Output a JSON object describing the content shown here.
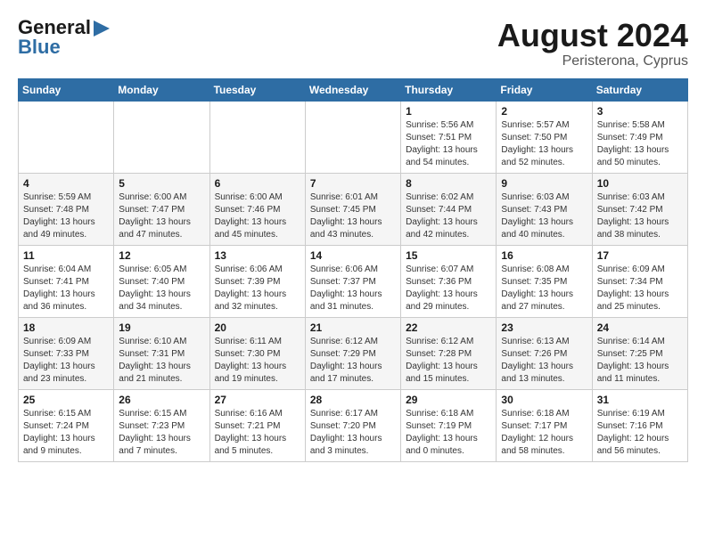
{
  "logo": {
    "general": "General",
    "blue": "Blue"
  },
  "header": {
    "month": "August 2024",
    "location": "Peristerona, Cyprus"
  },
  "weekdays": [
    "Sunday",
    "Monday",
    "Tuesday",
    "Wednesday",
    "Thursday",
    "Friday",
    "Saturday"
  ],
  "weeks": [
    [
      {
        "day": "",
        "info": ""
      },
      {
        "day": "",
        "info": ""
      },
      {
        "day": "",
        "info": ""
      },
      {
        "day": "",
        "info": ""
      },
      {
        "day": "1",
        "info": "Sunrise: 5:56 AM\nSunset: 7:51 PM\nDaylight: 13 hours\nand 54 minutes."
      },
      {
        "day": "2",
        "info": "Sunrise: 5:57 AM\nSunset: 7:50 PM\nDaylight: 13 hours\nand 52 minutes."
      },
      {
        "day": "3",
        "info": "Sunrise: 5:58 AM\nSunset: 7:49 PM\nDaylight: 13 hours\nand 50 minutes."
      }
    ],
    [
      {
        "day": "4",
        "info": "Sunrise: 5:59 AM\nSunset: 7:48 PM\nDaylight: 13 hours\nand 49 minutes."
      },
      {
        "day": "5",
        "info": "Sunrise: 6:00 AM\nSunset: 7:47 PM\nDaylight: 13 hours\nand 47 minutes."
      },
      {
        "day": "6",
        "info": "Sunrise: 6:00 AM\nSunset: 7:46 PM\nDaylight: 13 hours\nand 45 minutes."
      },
      {
        "day": "7",
        "info": "Sunrise: 6:01 AM\nSunset: 7:45 PM\nDaylight: 13 hours\nand 43 minutes."
      },
      {
        "day": "8",
        "info": "Sunrise: 6:02 AM\nSunset: 7:44 PM\nDaylight: 13 hours\nand 42 minutes."
      },
      {
        "day": "9",
        "info": "Sunrise: 6:03 AM\nSunset: 7:43 PM\nDaylight: 13 hours\nand 40 minutes."
      },
      {
        "day": "10",
        "info": "Sunrise: 6:03 AM\nSunset: 7:42 PM\nDaylight: 13 hours\nand 38 minutes."
      }
    ],
    [
      {
        "day": "11",
        "info": "Sunrise: 6:04 AM\nSunset: 7:41 PM\nDaylight: 13 hours\nand 36 minutes."
      },
      {
        "day": "12",
        "info": "Sunrise: 6:05 AM\nSunset: 7:40 PM\nDaylight: 13 hours\nand 34 minutes."
      },
      {
        "day": "13",
        "info": "Sunrise: 6:06 AM\nSunset: 7:39 PM\nDaylight: 13 hours\nand 32 minutes."
      },
      {
        "day": "14",
        "info": "Sunrise: 6:06 AM\nSunset: 7:37 PM\nDaylight: 13 hours\nand 31 minutes."
      },
      {
        "day": "15",
        "info": "Sunrise: 6:07 AM\nSunset: 7:36 PM\nDaylight: 13 hours\nand 29 minutes."
      },
      {
        "day": "16",
        "info": "Sunrise: 6:08 AM\nSunset: 7:35 PM\nDaylight: 13 hours\nand 27 minutes."
      },
      {
        "day": "17",
        "info": "Sunrise: 6:09 AM\nSunset: 7:34 PM\nDaylight: 13 hours\nand 25 minutes."
      }
    ],
    [
      {
        "day": "18",
        "info": "Sunrise: 6:09 AM\nSunset: 7:33 PM\nDaylight: 13 hours\nand 23 minutes."
      },
      {
        "day": "19",
        "info": "Sunrise: 6:10 AM\nSunset: 7:31 PM\nDaylight: 13 hours\nand 21 minutes."
      },
      {
        "day": "20",
        "info": "Sunrise: 6:11 AM\nSunset: 7:30 PM\nDaylight: 13 hours\nand 19 minutes."
      },
      {
        "day": "21",
        "info": "Sunrise: 6:12 AM\nSunset: 7:29 PM\nDaylight: 13 hours\nand 17 minutes."
      },
      {
        "day": "22",
        "info": "Sunrise: 6:12 AM\nSunset: 7:28 PM\nDaylight: 13 hours\nand 15 minutes."
      },
      {
        "day": "23",
        "info": "Sunrise: 6:13 AM\nSunset: 7:26 PM\nDaylight: 13 hours\nand 13 minutes."
      },
      {
        "day": "24",
        "info": "Sunrise: 6:14 AM\nSunset: 7:25 PM\nDaylight: 13 hours\nand 11 minutes."
      }
    ],
    [
      {
        "day": "25",
        "info": "Sunrise: 6:15 AM\nSunset: 7:24 PM\nDaylight: 13 hours\nand 9 minutes."
      },
      {
        "day": "26",
        "info": "Sunrise: 6:15 AM\nSunset: 7:23 PM\nDaylight: 13 hours\nand 7 minutes."
      },
      {
        "day": "27",
        "info": "Sunrise: 6:16 AM\nSunset: 7:21 PM\nDaylight: 13 hours\nand 5 minutes."
      },
      {
        "day": "28",
        "info": "Sunrise: 6:17 AM\nSunset: 7:20 PM\nDaylight: 13 hours\nand 3 minutes."
      },
      {
        "day": "29",
        "info": "Sunrise: 6:18 AM\nSunset: 7:19 PM\nDaylight: 13 hours\nand 0 minutes."
      },
      {
        "day": "30",
        "info": "Sunrise: 6:18 AM\nSunset: 7:17 PM\nDaylight: 12 hours\nand 58 minutes."
      },
      {
        "day": "31",
        "info": "Sunrise: 6:19 AM\nSunset: 7:16 PM\nDaylight: 12 hours\nand 56 minutes."
      }
    ]
  ]
}
